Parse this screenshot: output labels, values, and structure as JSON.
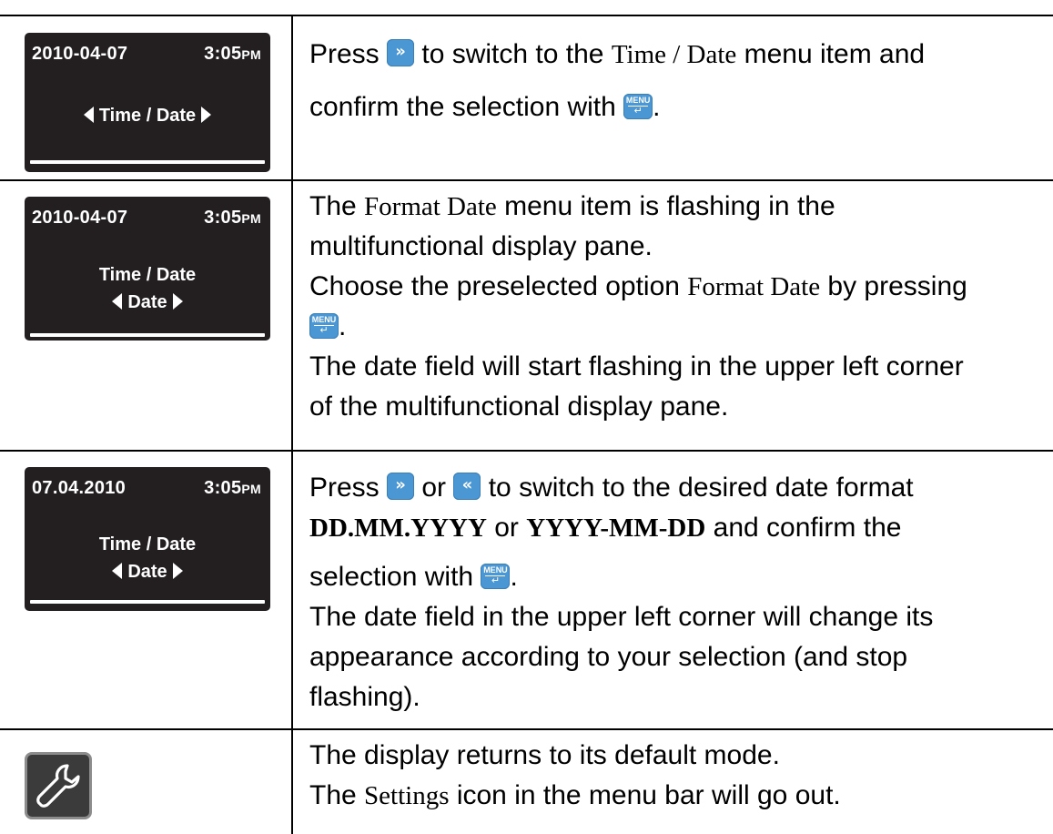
{
  "rows": [
    {
      "display": {
        "date": "2010-04-07",
        "time": "3:05",
        "ampm": "PM",
        "line1": "Time / Date",
        "line2": ""
      },
      "text": {
        "p1_a": "Press ",
        "p1_b": " to switch to the ",
        "p1_item": "Time / Date",
        "p1_c": " menu item and",
        "p2_a": "confirm the selection with ",
        "p2_b": "."
      }
    },
    {
      "display": {
        "date": "2010-04-07",
        "time": "3:05",
        "ampm": "PM",
        "line1": "Time / Date",
        "line2": "Date"
      },
      "text": {
        "p1_a": "The ",
        "p1_item": "Format Date",
        "p1_b": " menu item is flashing in the",
        "p2": "multifunctional display pane.",
        "p3_a": "Choose the preselected option ",
        "p3_item": "Format Date",
        "p3_b": " by pressing",
        "p4_b": ".",
        "p5": "The date field will start flashing in the upper left corner",
        "p6": "of the multifunctional display pane."
      }
    },
    {
      "display": {
        "date": "07.04.2010",
        "time": "3:05",
        "ampm": "PM",
        "line1": "Time / Date",
        "line2": "Date"
      },
      "text": {
        "p1_a": "Press ",
        "p1_b": " or ",
        "p1_c": " to switch to the desired date format",
        "p2_f1": "DD.MM.YYYY",
        "p2_or": " or ",
        "p2_f2": "YYYY-MM-DD",
        "p2_c": " and confirm the",
        "p3_a": "selection with ",
        "p3_b": ".",
        "p4": "The date field in the upper left corner will change its",
        "p5": "appearance according to your selection (and stop",
        "p6": "flashing)."
      }
    },
    {
      "icon": "wrench-icon",
      "text": {
        "p1": "The display returns to its default mode.",
        "p2_a": "The ",
        "p2_item": "Settings",
        "p2_b": " icon in the menu bar will go out."
      }
    }
  ],
  "buttons": {
    "next_glyph": "»",
    "prev_glyph": "«",
    "menu_label": "MENU",
    "enter_glyph": "↵"
  },
  "colors": {
    "button_blue": "#4a97d4",
    "lcd_background": "#231f20"
  }
}
